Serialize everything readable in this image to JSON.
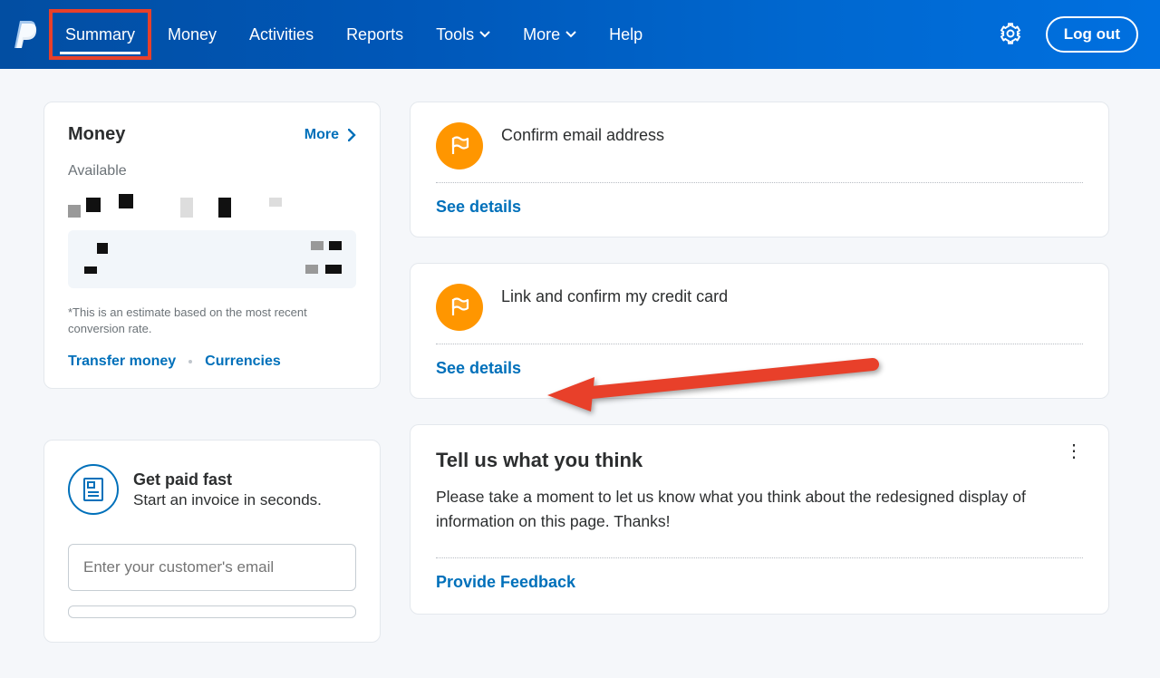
{
  "brand": {
    "logo_alt": "PayPal"
  },
  "nav": {
    "items": [
      {
        "label": "Summary",
        "active": true,
        "dropdown": false
      },
      {
        "label": "Money",
        "active": false,
        "dropdown": false
      },
      {
        "label": "Activities",
        "active": false,
        "dropdown": false
      },
      {
        "label": "Reports",
        "active": false,
        "dropdown": false
      },
      {
        "label": "Tools",
        "active": false,
        "dropdown": true
      },
      {
        "label": "More",
        "active": false,
        "dropdown": true
      },
      {
        "label": "Help",
        "active": false,
        "dropdown": false
      }
    ],
    "logout_label": "Log out"
  },
  "money": {
    "title": "Money",
    "more_label": "More",
    "available_label": "Available",
    "footnote": "*This is an estimate based on the most recent conversion rate.",
    "transfer_label": "Transfer money",
    "currencies_label": "Currencies"
  },
  "getpaid": {
    "title": "Get paid fast",
    "subtitle": "Start an invoice in seconds.",
    "email_placeholder": "Enter your customer's email"
  },
  "notifications": [
    {
      "title": "Confirm email address",
      "cta": "See details"
    },
    {
      "title": "Link and confirm my credit card",
      "cta": "See details"
    }
  ],
  "feedback": {
    "title": "Tell us what you think",
    "body": "Please take a moment to let us know what you think about the redesigned display of information on this page. Thanks!",
    "cta": "Provide Feedback"
  },
  "colors": {
    "link": "#0070ba",
    "flag_bg": "#ff9600",
    "highlight_box": "#e8402a"
  }
}
